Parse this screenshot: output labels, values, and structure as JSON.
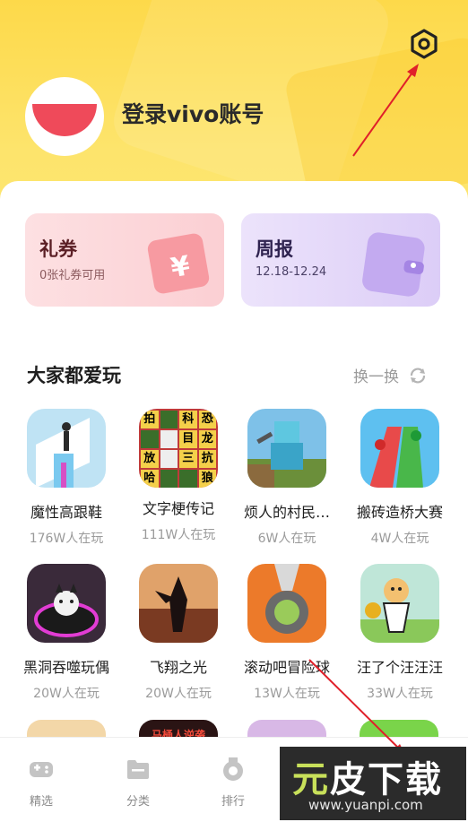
{
  "header": {
    "login_text": "登录vivo账号"
  },
  "cards": {
    "coupon": {
      "title": "礼券",
      "subtitle": "0张礼券可用"
    },
    "weekly": {
      "title": "周报",
      "subtitle": "12.18-12.24"
    }
  },
  "section": {
    "title": "大家都爱玩",
    "refresh_label": "换一换"
  },
  "games": [
    {
      "name": "魔性高跟鞋",
      "players": "176W人在玩"
    },
    {
      "name": "文字梗传记",
      "players": "111W人在玩",
      "grid": [
        "拍",
        "科",
        "恐",
        "目",
        "龙",
        "放",
        "三",
        "抗",
        "哈",
        "狼"
      ]
    },
    {
      "name": "烦人的村民…",
      "players": "6W人在玩"
    },
    {
      "name": "搬砖造桥大赛",
      "players": "4W人在玩"
    },
    {
      "name": "黑洞吞噬玩偶",
      "players": "20W人在玩"
    },
    {
      "name": "飞翔之光",
      "players": "20W人在玩"
    },
    {
      "name": "滚动吧冒险球",
      "players": "13W人在玩"
    },
    {
      "name": "汪了个汪汪汪",
      "players": "33W人在玩"
    }
  ],
  "partial_banner_text": "马桶人逆袭",
  "nav": [
    {
      "label": "精选"
    },
    {
      "label": "分类"
    },
    {
      "label": "排行"
    }
  ],
  "watermark": {
    "line1_a": "元",
    "line1_b": "皮下载",
    "line2": "www.yuanpi.com"
  },
  "colors": {
    "accent_red": "#ef4a5a",
    "header_yellow": "#fdd94a",
    "annotation_arrow": "#e0202a"
  }
}
